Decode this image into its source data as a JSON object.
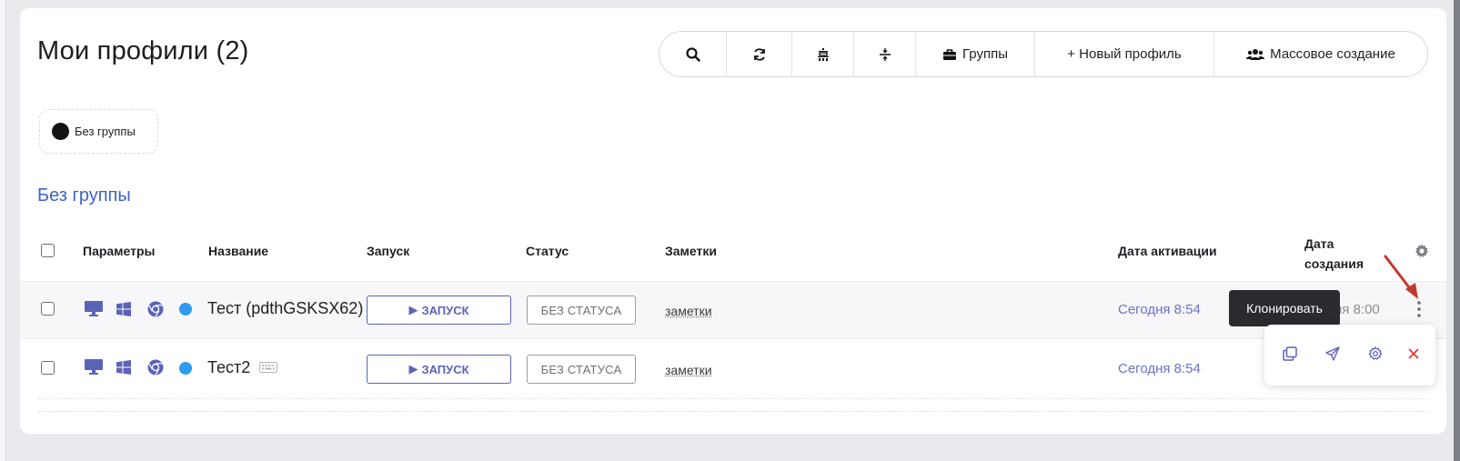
{
  "page": {
    "title": "Мои профили (2)"
  },
  "toolbar": {
    "items": [
      {
        "icon": "search-icon"
      },
      {
        "icon": "refresh-icon"
      },
      {
        "icon": "proxy-icon"
      },
      {
        "icon": "collapse-icon"
      },
      {
        "icon": "briefcase-icon",
        "label": "Группы"
      },
      {
        "icon": "plus-icon",
        "label": "+ Новый профиль"
      },
      {
        "icon": "users-icon",
        "label": "Массовое создание"
      }
    ]
  },
  "group_filter": {
    "label": "Без группы",
    "color": "#141414"
  },
  "section": {
    "title": "Без группы"
  },
  "table": {
    "headers": {
      "params": "Параметры",
      "name": "Название",
      "launch": "Запуск",
      "status": "Статус",
      "notes": "Заметки",
      "activation": "Дата активации",
      "created": "Дата создания"
    },
    "rows": [
      {
        "name": "Тест (pdthGSKSX62)",
        "launch_label": "ЗАПУСК",
        "status": "БЕЗ СТАТУСА",
        "notes": "заметки",
        "activation": "Сегодня 8:54",
        "created": "ня 8:00"
      },
      {
        "name": "Тест2",
        "launch_label": "ЗАПУСК",
        "status": "БЕЗ СТАТУСА",
        "notes": "заметки",
        "activation": "Сегодня 8:54",
        "created": ""
      }
    ]
  },
  "tooltip": {
    "text": "Клонировать"
  },
  "colors": {
    "accent": "#5b63b8",
    "link": "#3e63c9",
    "status_dot": "#2d9cf0",
    "danger": "#e53935",
    "arrow": "#c0392b"
  }
}
